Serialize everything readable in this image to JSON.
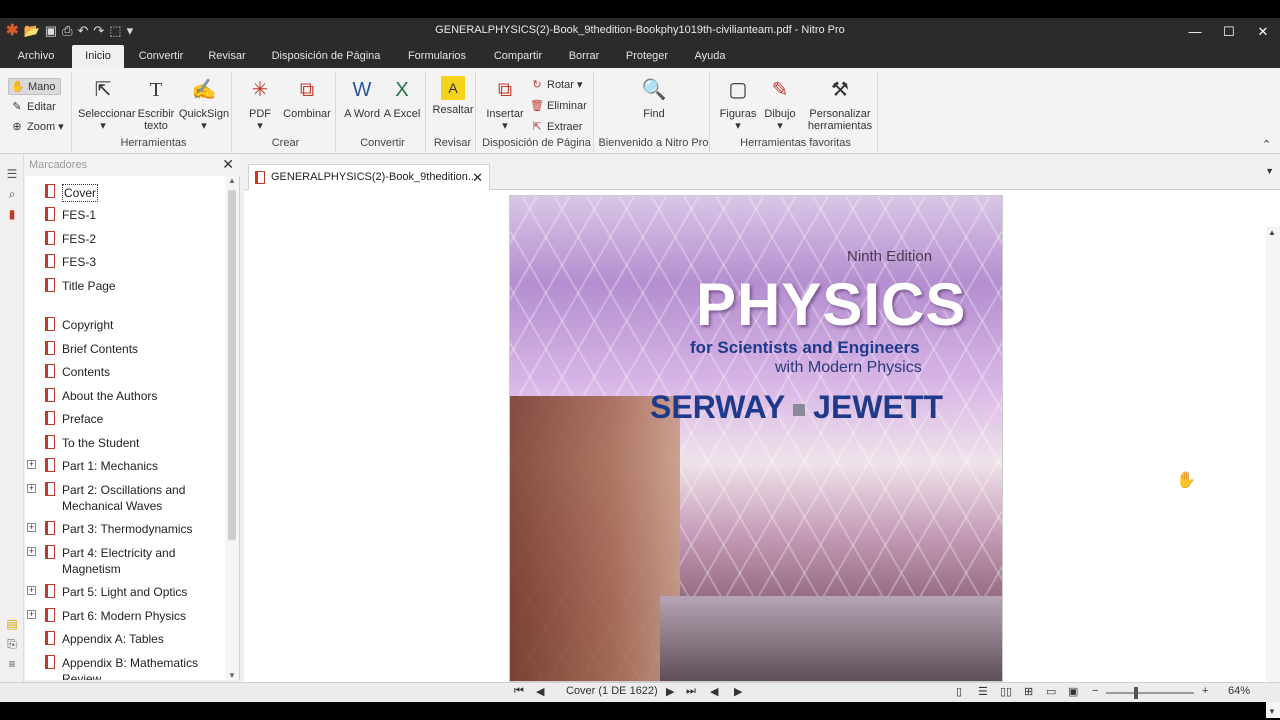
{
  "window": {
    "title": "GENERALPHYSICS(2)-Book_9thedition-Bookphy1019th-civilianteam.pdf - Nitro Pro"
  },
  "menu": [
    "Archivo",
    "Inicio",
    "Convertir",
    "Revisar",
    "Disposición de Página",
    "Formularios",
    "Compartir",
    "Borrar",
    "Proteger",
    "Ayuda"
  ],
  "ribbon": {
    "mode": {
      "mano": "Mano",
      "editar": "Editar",
      "zoom": "Zoom"
    },
    "herramientas": {
      "label": "Herramientas",
      "seleccionar": "Seleccionar",
      "escribir": "Escribir texto",
      "quicksign": "QuickSign"
    },
    "crear": {
      "label": "Crear",
      "pdf": "PDF",
      "combinar": "Combinar"
    },
    "convertir": {
      "label": "Convertir",
      "word": "A Word",
      "excel": "A Excel"
    },
    "revisar": {
      "label": "Revisar",
      "resaltar": "Resaltar"
    },
    "disposicion": {
      "label": "Disposición de Página",
      "insertar": "Insertar",
      "rotar": "Rotar",
      "eliminar": "Eliminar",
      "extraer": "Extraer"
    },
    "bienvenido": {
      "label": "Bienvenido a Nitro Pro",
      "find": "Find"
    },
    "favoritas": {
      "label": "Herramientas favoritas",
      "figuras": "Figuras",
      "dibujo": "Dibujo",
      "personalizar": "Personalizar herramientas"
    }
  },
  "bookmarks": {
    "title": "Marcadores",
    "items": [
      {
        "label": "Cover",
        "expandable": false
      },
      {
        "label": "FES-1",
        "expandable": false
      },
      {
        "label": "FES-2",
        "expandable": false
      },
      {
        "label": "FES-3",
        "expandable": false
      },
      {
        "label": "Title Page",
        "expandable": false
      },
      {
        "label": "Copyright",
        "expandable": false
      },
      {
        "label": "Brief Contents",
        "expandable": false
      },
      {
        "label": "Contents",
        "expandable": false
      },
      {
        "label": "About the Authors",
        "expandable": false
      },
      {
        "label": "Preface",
        "expandable": false
      },
      {
        "label": "To the Student",
        "expandable": false
      },
      {
        "label": "Part 1: Mechanics",
        "expandable": true
      },
      {
        "label": "Part 2: Oscillations and Mechanical Waves",
        "expandable": true
      },
      {
        "label": "Part 3: Thermodynamics",
        "expandable": true
      },
      {
        "label": "Part 4: Electricity and Magnetism",
        "expandable": true
      },
      {
        "label": "Part 5: Light and Optics",
        "expandable": true
      },
      {
        "label": "Part 6: Modern Physics",
        "expandable": true
      },
      {
        "label": "Appendix A: Tables",
        "expandable": false
      },
      {
        "label": "Appendix B: Mathematics Review",
        "expandable": false
      }
    ]
  },
  "tab": {
    "label": "GENERALPHYSICS(2)-Book_9thedition..."
  },
  "cover": {
    "edition": "Ninth Edition",
    "title": "PHYSICS",
    "subtitle1": "for Scientists and Engineers",
    "subtitle2": "with Modern Physics",
    "author1": "SERWAY",
    "author2": "JEWETT"
  },
  "status": {
    "page": "Cover (1 DE 1622)",
    "zoom": "64%"
  }
}
